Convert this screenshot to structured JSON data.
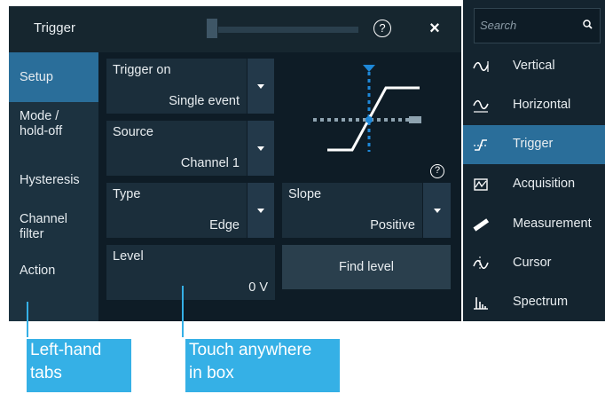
{
  "dialog": {
    "title": "Trigger",
    "help_symbol": "?",
    "close_symbol": "×"
  },
  "tabs": [
    {
      "label": "Setup",
      "active": true
    },
    {
      "label": "Mode /\nhold-off",
      "active": false
    },
    {
      "label": "Hysteresis",
      "active": false
    },
    {
      "label": "Channel\nfilter",
      "active": false
    },
    {
      "label": "Action",
      "active": false
    }
  ],
  "fields": {
    "trigger_on": {
      "label": "Trigger on",
      "value": "Single event"
    },
    "source": {
      "label": "Source",
      "value": "Channel 1"
    },
    "type": {
      "label": "Type",
      "value": "Edge"
    },
    "slope": {
      "label": "Slope",
      "value": "Positive"
    },
    "level": {
      "label": "Level",
      "value": "0 V"
    }
  },
  "buttons": {
    "find_level": "Find level"
  },
  "diagram": {
    "help_symbol": "?"
  },
  "toolbar": {
    "search_placeholder": "Search",
    "items": [
      {
        "label": "Vertical",
        "icon": "vertical-icon",
        "active": false
      },
      {
        "label": "Horizontal",
        "icon": "horizontal-icon",
        "active": false
      },
      {
        "label": "Trigger",
        "icon": "trigger-icon",
        "active": true
      },
      {
        "label": "Acquisition",
        "icon": "acquisition-icon",
        "active": false
      },
      {
        "label": "Measurement",
        "icon": "measurement-icon",
        "active": false
      },
      {
        "label": "Cursor",
        "icon": "cursor-icon",
        "active": false
      },
      {
        "label": "Spectrum",
        "icon": "spectrum-icon",
        "active": false
      }
    ]
  },
  "annotations": {
    "left_tabs": "Left-hand\ntabs",
    "touch_box": "Touch anywhere\nin box"
  },
  "colors": {
    "accent": "#2a6e9a",
    "callout": "#35b0e6",
    "diagram_marker": "#1e88d8"
  }
}
